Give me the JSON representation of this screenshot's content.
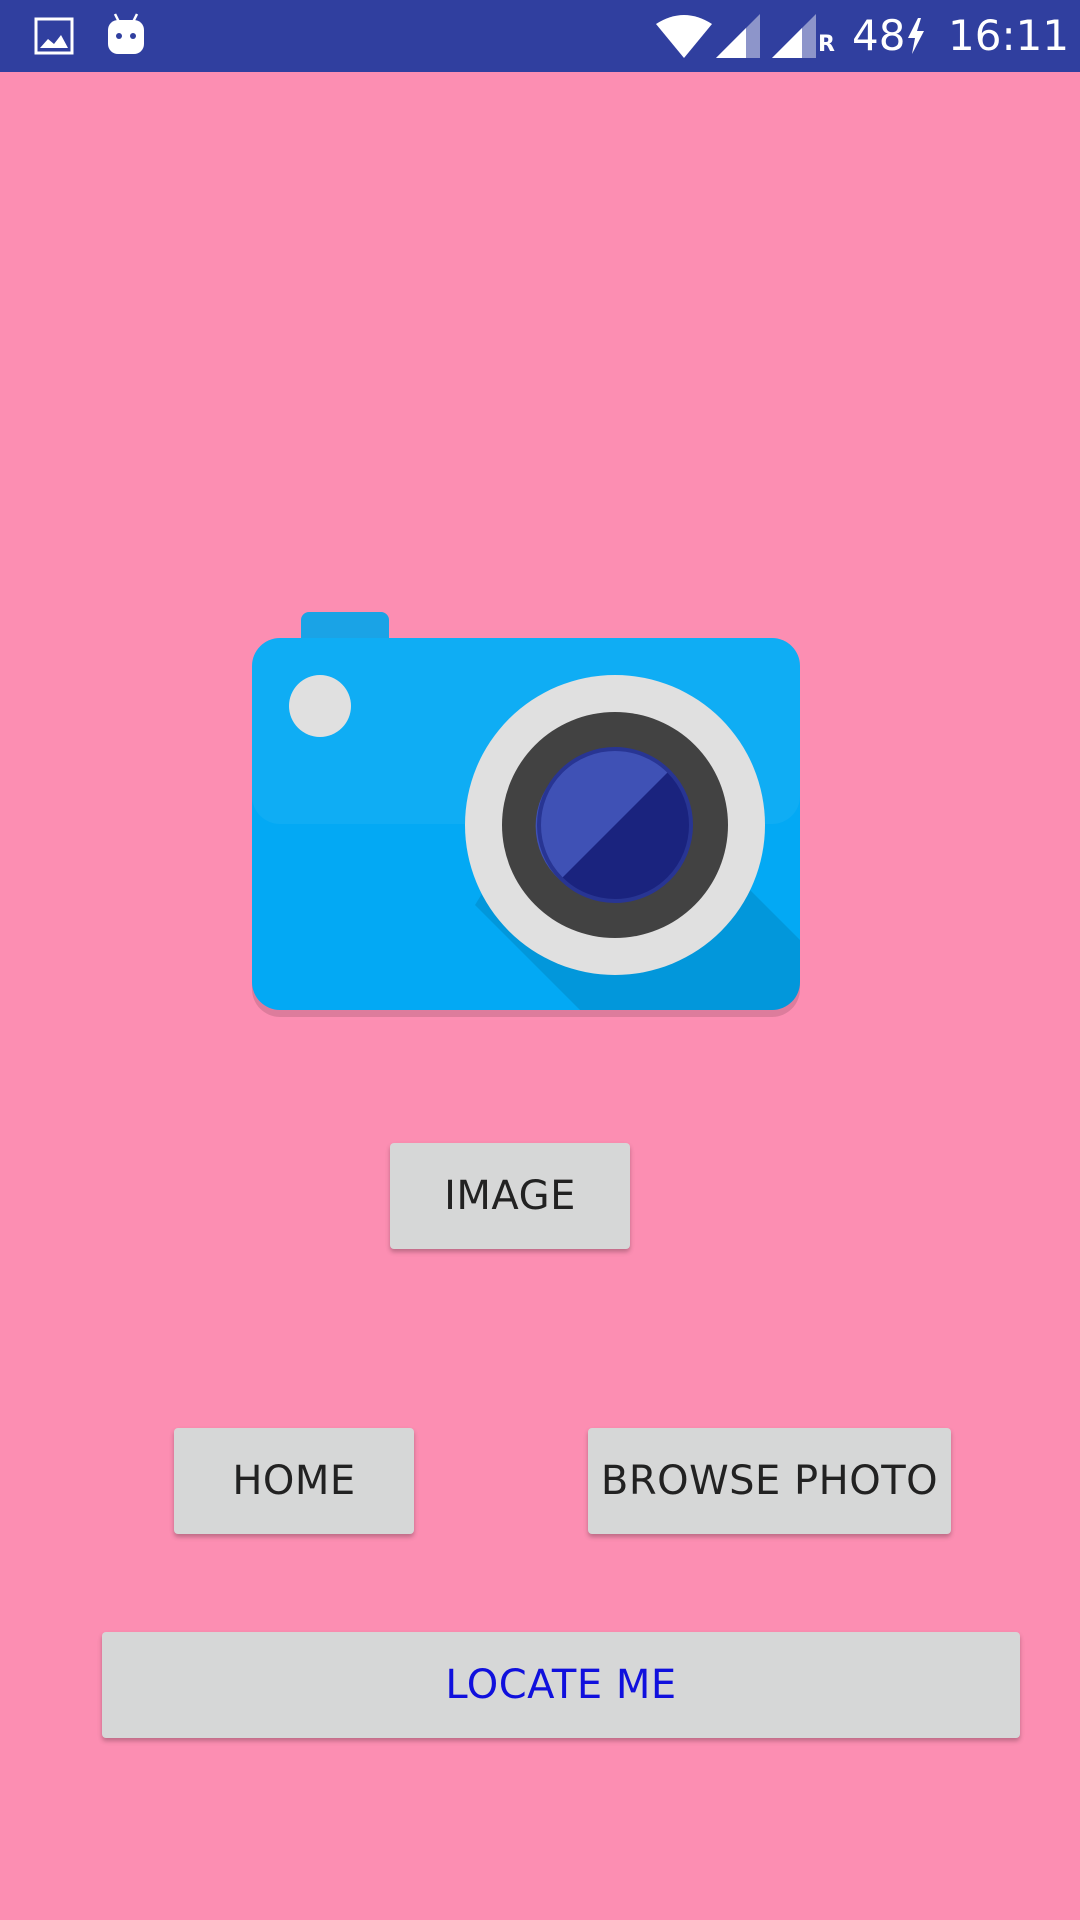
{
  "status_bar": {
    "icons": [
      "image-notification-icon",
      "android-notification-icon",
      "wifi-icon",
      "signal-icon",
      "signal-roaming-icon",
      "battery-charging-icon"
    ],
    "roaming_label": "R",
    "battery_level": "48",
    "time": "16:11"
  },
  "main": {
    "illustration": "camera-icon",
    "image_button_label": "IMAGE",
    "home_button_label": "HOME",
    "browse_photo_button_label": "BROWSE PHOTO",
    "locate_me_button_label": "LOCATE ME"
  },
  "colors": {
    "background": "#FC8EB2",
    "status_bar": "#303F9F",
    "button": "#D6D7D7",
    "button_text": "#222222",
    "locate_text": "#1010DD",
    "camera_body": "#03A9F4"
  }
}
